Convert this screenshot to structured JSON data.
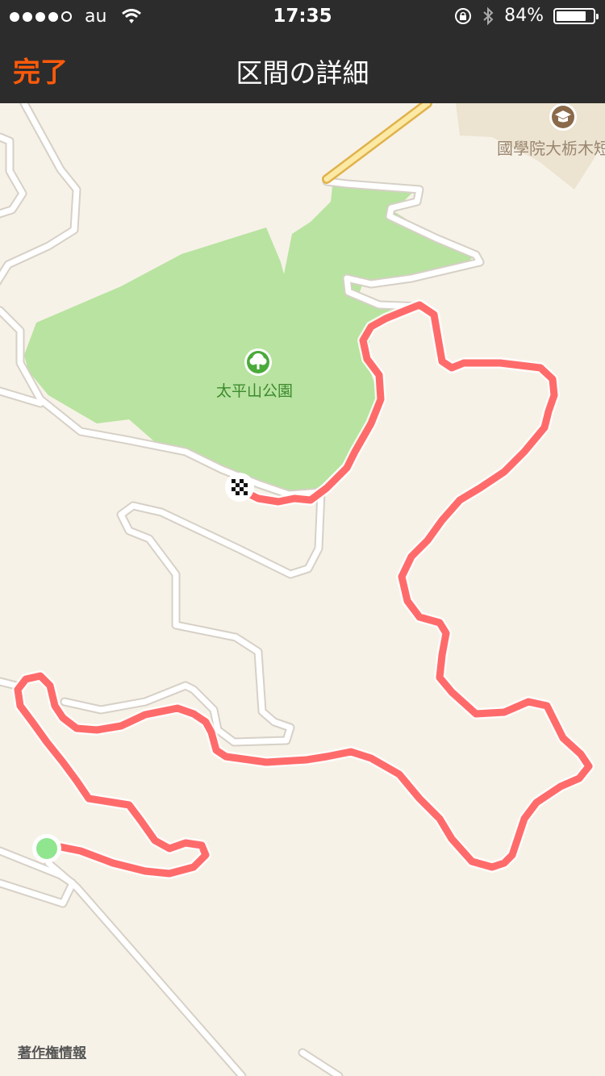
{
  "status_bar": {
    "carrier": "au",
    "time": "17:35",
    "battery_percent": "84%",
    "battery_level": 0.84,
    "signal_bars_filled": 4,
    "signal_bars_total": 5
  },
  "nav": {
    "done_label": "完了",
    "title": "区間の詳細",
    "accent_color": "#ff5a0a"
  },
  "map": {
    "park_label": "太平山公園",
    "university_label": "國學院大栃木短",
    "copyright_label": "著作権情報",
    "route_color": "#ff6b6b",
    "park_color": "#b8e3a0",
    "start_marker_color": "#8fe68f",
    "finish_marker_icon": "checkered-flag-icon",
    "park_icon": "tree-icon",
    "university_icon": "graduation-cap-icon"
  }
}
